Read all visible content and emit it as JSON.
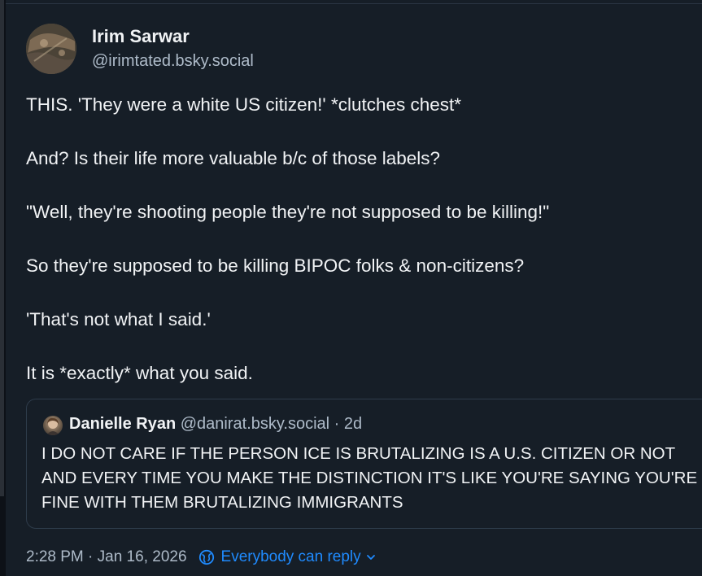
{
  "post": {
    "author": {
      "display_name": "Irim Sarwar",
      "handle": "@irimtated.bsky.social"
    },
    "paragraphs": [
      "THIS. 'They were a white US citizen!' *clutches chest*",
      "And? Is their life more valuable b/c of those labels?",
      "\"Well, they're shooting people they're not supposed to be killing!\"",
      "So they're supposed to be killing BIPOC folks & non-citizens?",
      "'That's not what I said.'",
      "It is *exactly* what you said."
    ],
    "quote": {
      "display_name": "Danielle Ryan",
      "handle": "@danirat.bsky.social",
      "age": "· 2d",
      "text": "I DO NOT CARE IF THE PERSON ICE IS BRUTALIZING IS A U.S. CITIZEN OR NOT AND EVERY TIME YOU MAKE THE DISTINCTION IT'S LIKE YOU'RE SAYING YOU'RE FINE WITH THEM BRUTALIZING IMMIGRANTS"
    },
    "timestamp": "2:28 PM · Jan 16, 2026",
    "reply_setting": {
      "label": "Everybody can reply",
      "icon": "globe-icon",
      "chevron": "chevron-down-icon"
    }
  },
  "colors": {
    "background": "#161e27",
    "text": "#f1f3f5",
    "muted": "#aebbc9",
    "accent": "#1f8bff",
    "border": "#2e3c4b"
  }
}
